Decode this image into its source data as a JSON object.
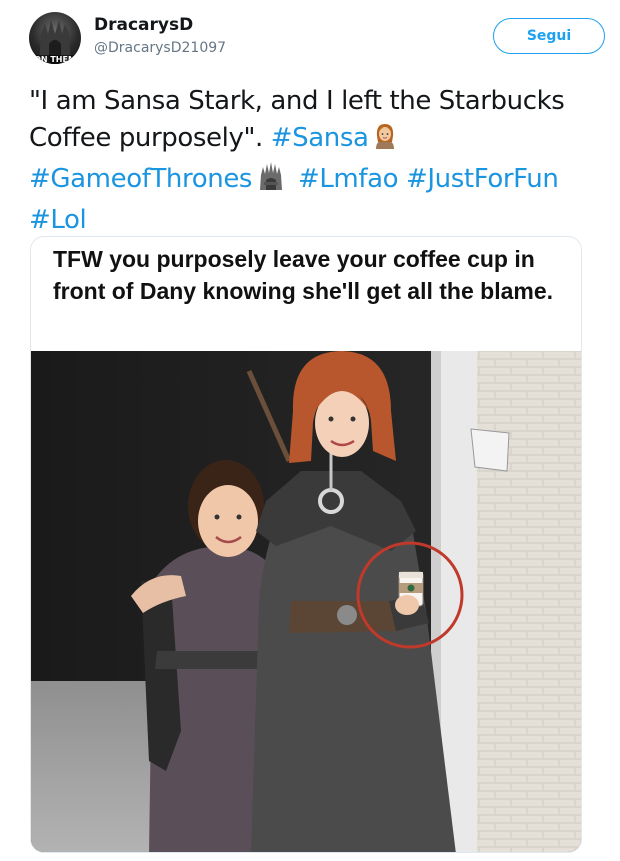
{
  "user": {
    "display_name": "DracarysD",
    "handle": "@DracarysD21097",
    "avatar_overlay_text": "ON THEM"
  },
  "follow_label": "Segui",
  "tweet": {
    "text_part1": "\"I am Sansa Stark, and I left the Starbucks Coffee purposely\".",
    "hashtags": [
      "#Sansa",
      "#GameofThrones",
      "#Lmfao",
      "#JustForFun",
      "#Lol"
    ]
  },
  "media": {
    "caption": "TFW you purposely leave your coffee cup in front of Dany knowing she'll get all the blame."
  },
  "colors": {
    "accent": "#1da1f2",
    "hashtag": "#1b95e0",
    "circle": "#c0392b"
  },
  "icons": [
    "woman-emoji-icon",
    "iron-throne-emoji-icon"
  ]
}
